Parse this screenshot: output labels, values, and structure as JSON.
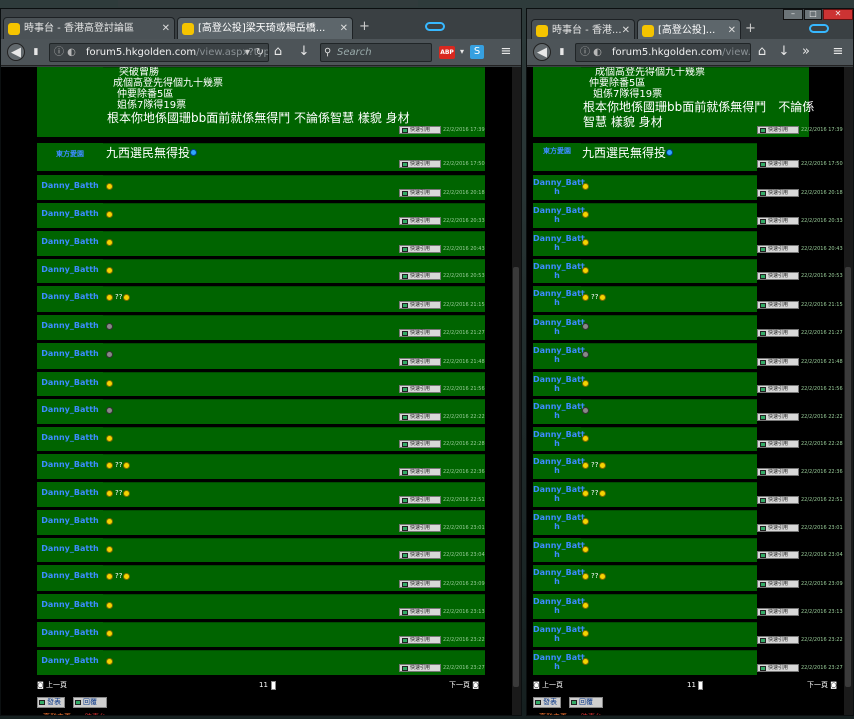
{
  "left": {
    "tabs": [
      {
        "label": "時事台 - 香港高登討論區"
      },
      {
        "label": "[高登公投]梁天琦或楊岳橋..."
      }
    ],
    "url_host": "forum5.hkgolden.com",
    "url_path": "/view.aspx?type",
    "search_placeholder": "Search",
    "top_text_lines": [
      "突破曾勝",
      "成個高登先得個九十幾票",
      "仲要除番5區",
      "姐係7隊得19票"
    ],
    "top_big_text": "根本你地係國珊bb面前就係無得鬥 不論係智慧 樣貌 身材",
    "top_time": "22/2/2016 17:39",
    "posts": [
      {
        "author": "東方愛園",
        "text": "九西選民無得投",
        "time": "22/2/2016 17:50"
      },
      {
        "author": "Danny_Batth",
        "text": "",
        "time": "22/2/2016 20:18"
      },
      {
        "author": "Danny_Batth",
        "text": "",
        "time": "22/2/2016 20:33"
      },
      {
        "author": "Danny_Batth",
        "text": "",
        "time": "22/2/2016 20:43"
      },
      {
        "author": "Danny_Batth",
        "text": "",
        "time": "22/2/2016 20:53"
      },
      {
        "author": "Danny_Batth",
        "text": "",
        "time": "22/2/2016 21:15"
      },
      {
        "author": "Danny_Batth",
        "text": "",
        "time": "22/2/2016 21:27"
      },
      {
        "author": "Danny_Batth",
        "text": "",
        "time": "22/2/2016 21:48"
      },
      {
        "author": "Danny_Batth",
        "text": "",
        "time": "22/2/2016 21:56"
      },
      {
        "author": "Danny_Batth",
        "text": "",
        "time": "22/2/2016 22:22"
      },
      {
        "author": "Danny_Batth",
        "text": "",
        "time": "22/2/2016 22:28"
      },
      {
        "author": "Danny_Batth",
        "text": "",
        "time": "22/2/2016 22:36"
      },
      {
        "author": "Danny_Batth",
        "text": "",
        "time": "22/2/2016 22:51"
      },
      {
        "author": "Danny_Batth",
        "text": "",
        "time": "22/2/2016 23:01"
      },
      {
        "author": "Danny_Batth",
        "text": "",
        "time": "22/2/2016 23:04"
      },
      {
        "author": "Danny_Batth",
        "text": "",
        "time": "22/2/2016 23:09"
      },
      {
        "author": "Danny_Batth",
        "text": "",
        "time": "22/2/2016 23:13"
      },
      {
        "author": "Danny_Batth",
        "text": "",
        "time": "22/2/2016 23:22"
      },
      {
        "author": "Danny_Batth",
        "text": "",
        "time": "22/2/2016 23:27"
      }
    ],
    "quote_label": "快速引用",
    "ti_label": "??",
    "prev_label": "上一頁",
    "next_label": "下一頁",
    "page": "11",
    "reply_label": "發表",
    "reply2_label": "回覆",
    "home_label": "高登主頁",
    "forum_label": "時事台"
  },
  "right": {
    "tabs": [
      {
        "label": "時事台 - 香港..."
      },
      {
        "label": "[高登公投]..."
      }
    ],
    "url_host": "forum5.hkgolden.com",
    "url_path": "/view.aspx?",
    "top_text_lines": [
      "成個高登先得個九十幾票",
      "仲要除番5區",
      "姐係7隊得19票"
    ],
    "top_big_text_1": "根本你地係國珊bb面前就係無得鬥　不論係",
    "top_big_text_2": "智慧 樣貌 身材",
    "top_time": "22/2/2016 17:39",
    "author_line1": "Danny_Batt",
    "author_line2": "h"
  },
  "colors": {
    "post_bg": "#006400",
    "author": "#3c8cff",
    "page_bg": "#000000",
    "accent_mask": "#37b8ff"
  }
}
